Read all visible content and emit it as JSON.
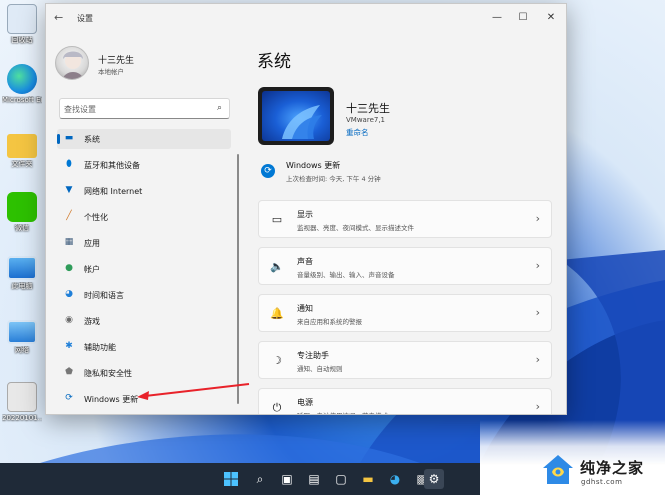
{
  "desktop": {
    "icons": [
      {
        "label": "回收站"
      },
      {
        "label": "Microsoft Edge"
      },
      {
        "label": "文件夹"
      },
      {
        "label": "微信"
      },
      {
        "label": "此电脑"
      },
      {
        "label": "网络"
      },
      {
        "label": "20220101..."
      }
    ]
  },
  "window": {
    "title": "设置",
    "controls": {
      "minimize": "—",
      "maximize": "☐",
      "close": "✕"
    }
  },
  "sidebar": {
    "user_name": "十三先生",
    "user_type": "本地帐户",
    "search_placeholder": "查找设置",
    "items": [
      {
        "label": "系统",
        "icon": "monitor-icon",
        "glyph": "▬",
        "color": "#0067c0",
        "active": true
      },
      {
        "label": "蓝牙和其他设备",
        "icon": "bluetooth-icon",
        "glyph": "⬮",
        "color": "#0078d4",
        "active": false
      },
      {
        "label": "网络和 Internet",
        "icon": "wifi-icon",
        "glyph": "▼",
        "color": "#0067c0",
        "active": false
      },
      {
        "label": "个性化",
        "icon": "brush-icon",
        "glyph": "╱",
        "color": "#d0792a",
        "active": false
      },
      {
        "label": "应用",
        "icon": "apps-icon",
        "glyph": "▦",
        "color": "#3c5a7a",
        "active": false
      },
      {
        "label": "帐户",
        "icon": "person-icon",
        "glyph": "●",
        "color": "#2f9c5a",
        "active": false
      },
      {
        "label": "时间和语言",
        "icon": "globe-clock-icon",
        "glyph": "◕",
        "color": "#1f7fd8",
        "active": false
      },
      {
        "label": "游戏",
        "icon": "gamepad-icon",
        "glyph": "◉",
        "color": "#6a6a6a",
        "active": false
      },
      {
        "label": "辅助功能",
        "icon": "accessibility-icon",
        "glyph": "✱",
        "color": "#1f7fd8",
        "active": false
      },
      {
        "label": "隐私和安全性",
        "icon": "shield-icon",
        "glyph": "⬟",
        "color": "#777777",
        "active": false
      },
      {
        "label": "Windows 更新",
        "icon": "windows-update-icon",
        "glyph": "⟳",
        "color": "#0067c0",
        "active": false
      }
    ]
  },
  "main": {
    "title": "系统",
    "device": {
      "name": "十三先生",
      "model": "VMware7,1",
      "rename": "重命名"
    },
    "update": {
      "title": "Windows 更新",
      "subtitle": "上次检查时间: 今天, 下午 4 分钟"
    },
    "cards": [
      {
        "title": "显示",
        "subtitle": "监视器、亮度、夜间模式、显示描述文件",
        "icon": "display-icon",
        "glyph": "▭"
      },
      {
        "title": "声音",
        "subtitle": "音量级别、输出、输入、声音设备",
        "icon": "speaker-icon",
        "glyph": "🔈"
      },
      {
        "title": "通知",
        "subtitle": "来自应用和系统的警报",
        "icon": "bell-icon",
        "glyph": "🔔"
      },
      {
        "title": "专注助手",
        "subtitle": "通知、自动规则",
        "icon": "moon-icon",
        "glyph": "☽"
      },
      {
        "title": "电源",
        "subtitle": "睡眠、电池使用情况、节电模式",
        "icon": "power-icon",
        "glyph": "⏻"
      }
    ],
    "chevron": "›"
  },
  "watermark": {
    "name": "纯净之家",
    "url": "gdhst.com"
  }
}
